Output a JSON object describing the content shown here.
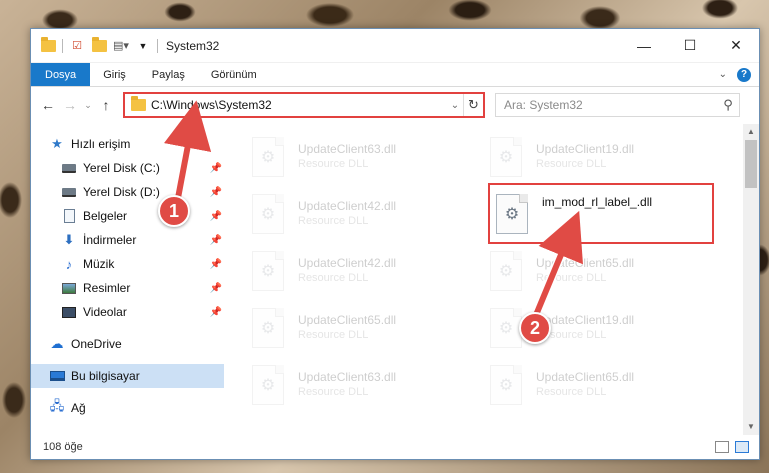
{
  "window": {
    "title": "System32",
    "controls": {
      "minimize": "—",
      "maximize": "☐",
      "close": "✕"
    }
  },
  "ribbon": {
    "tabs": [
      "Dosya",
      "Giriş",
      "Paylaş",
      "Görünüm"
    ]
  },
  "address": {
    "path": "C:\\Windows\\System32",
    "search_placeholder": "Ara: System32"
  },
  "sidebar": {
    "quick_access": "Hızlı erişim",
    "items": [
      {
        "label": "Yerel Disk (C:)",
        "icon": "drive-icon"
      },
      {
        "label": "Yerel Disk (D:)",
        "icon": "drive-icon"
      },
      {
        "label": "Belgeler",
        "icon": "document-icon"
      },
      {
        "label": "İndirmeler",
        "icon": "download-icon"
      },
      {
        "label": "Müzik",
        "icon": "music-icon"
      },
      {
        "label": "Resimler",
        "icon": "picture-icon"
      },
      {
        "label": "Videolar",
        "icon": "video-icon"
      }
    ],
    "onedrive": "OneDrive",
    "this_pc": "Bu bilgisayar",
    "network": "Ağ"
  },
  "files": [
    {
      "name": "UpdateClient63.dll",
      "type": "Resource DLL"
    },
    {
      "name": "UpdateClient19.dll",
      "type": "Resource DLL"
    },
    {
      "name": "UpdateClient42.dll",
      "type": "Resource DLL"
    },
    {
      "name": "im_mod_rl_label_.dll",
      "type": ""
    },
    {
      "name": "UpdateClient42.dll",
      "type": "Resource DLL"
    },
    {
      "name": "UpdateClient65.dll",
      "type": "Resource DLL"
    },
    {
      "name": "UpdateClient65.dll",
      "type": "Resource DLL"
    },
    {
      "name": "UpdateClient19.dll",
      "type": "Resource DLL"
    },
    {
      "name": "UpdateClient63.dll",
      "type": "Resource DLL"
    },
    {
      "name": "UpdateClient65.dll",
      "type": "Resource DLL"
    }
  ],
  "status": {
    "item_count": "108 öğe"
  },
  "annotations": {
    "step1": "1",
    "step2": "2"
  },
  "colors": {
    "accent": "#1979ca",
    "highlight": "#e2413f",
    "callout": "#e04b45"
  }
}
